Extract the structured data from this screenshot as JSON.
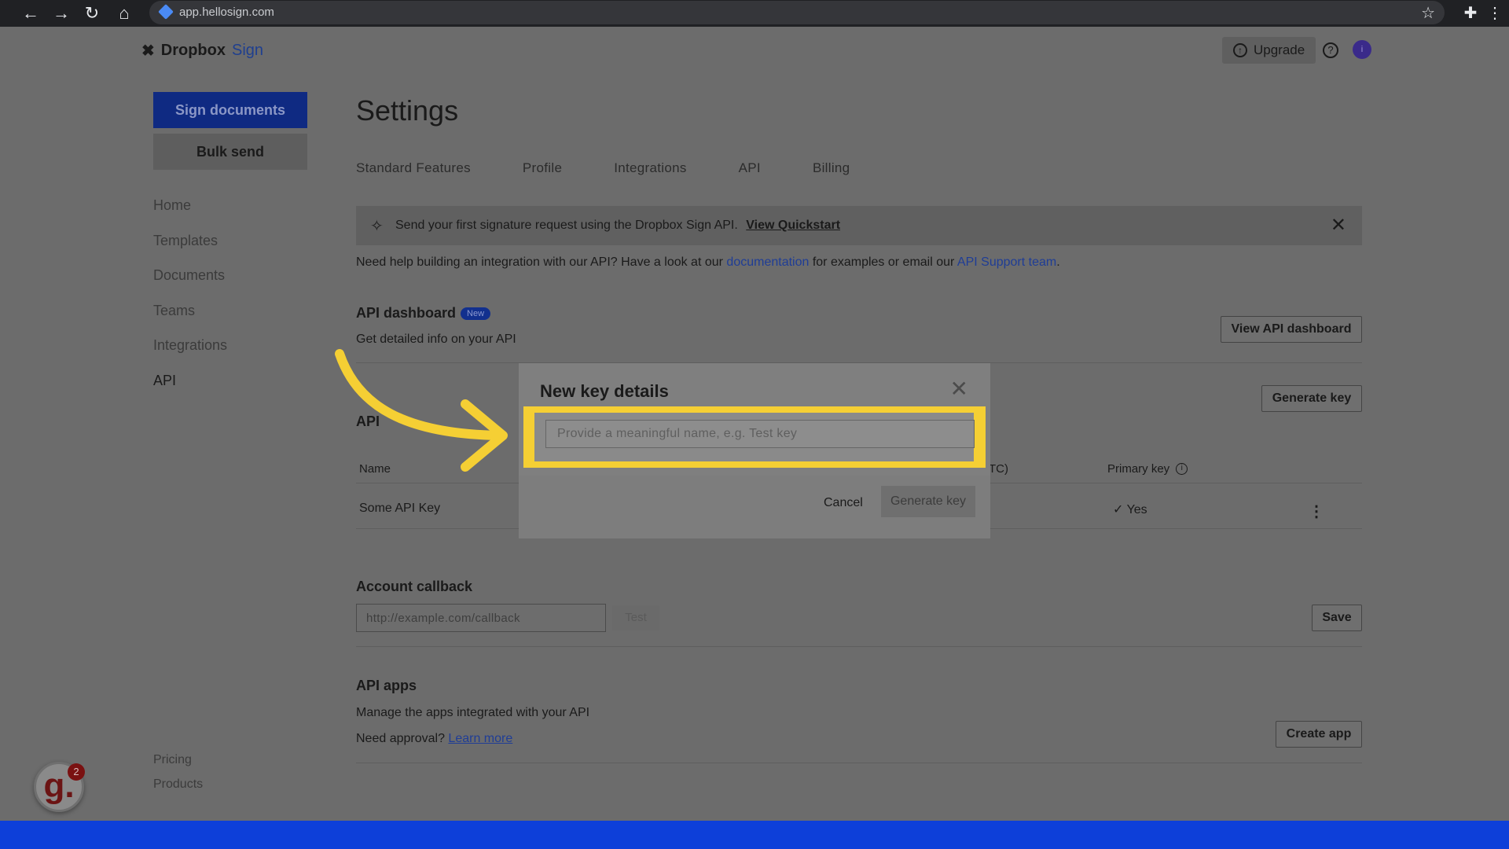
{
  "browser": {
    "url": "app.hellosign.com",
    "back_icon": "arrow-left-icon",
    "forward_icon": "arrow-right-icon",
    "reload_icon": "reload-icon",
    "home_icon": "home-icon"
  },
  "header": {
    "logo_primary": "Dropbox",
    "logo_secondary": "Sign",
    "upgrade_label": "Upgrade",
    "avatar_initial": "i"
  },
  "sidebar": {
    "sign_documents": "Sign documents",
    "bulk_send": "Bulk send",
    "items": [
      {
        "label": "Home"
      },
      {
        "label": "Templates"
      },
      {
        "label": "Documents"
      },
      {
        "label": "Teams"
      },
      {
        "label": "Integrations"
      },
      {
        "label": "API"
      }
    ],
    "footer": [
      "Pricing",
      "Products"
    ]
  },
  "main": {
    "title": "Settings",
    "tabs": [
      "Standard Features",
      "Profile",
      "Integrations",
      "API",
      "Billing"
    ],
    "banner": {
      "text": "Send your first signature request using the Dropbox Sign API.",
      "link": "View Quickstart"
    },
    "help": {
      "before": "Need help building an integration with our API? Have a look at our ",
      "doc_link": "documentation",
      "middle": " for examples or email our ",
      "support_link": "API Support team",
      "after": "."
    },
    "dashboard": {
      "title": "API dashboard",
      "badge": "New",
      "desc": "Get detailed info on your API",
      "button": "View API dashboard"
    },
    "keys": {
      "title": "API",
      "generate_button": "Generate key",
      "col_name": "Name",
      "col_created_suffix": "TC)",
      "col_primary": "Primary key",
      "row_name": "Some API Key",
      "row_primary": "✓ Yes"
    },
    "callback": {
      "title": "Account callback",
      "placeholder": "http://example.com/callback",
      "test_label": "Test",
      "save_label": "Save"
    },
    "apps": {
      "title": "API apps",
      "desc": "Manage the apps integrated with your API",
      "approval_text": "Need approval? ",
      "approval_link": "Learn more",
      "create_button": "Create app"
    }
  },
  "modal": {
    "title": "New key details",
    "placeholder": "Provide a meaningful name, e.g. Test key",
    "cancel": "Cancel",
    "generate": "Generate key"
  },
  "badge": {
    "letter": "g.",
    "count": "2"
  },
  "colors": {
    "highlight": "#f5cf34",
    "arrow": "#f5cf34",
    "primary": "#0f2a82",
    "bottom_strip": "#0d3fd9"
  }
}
